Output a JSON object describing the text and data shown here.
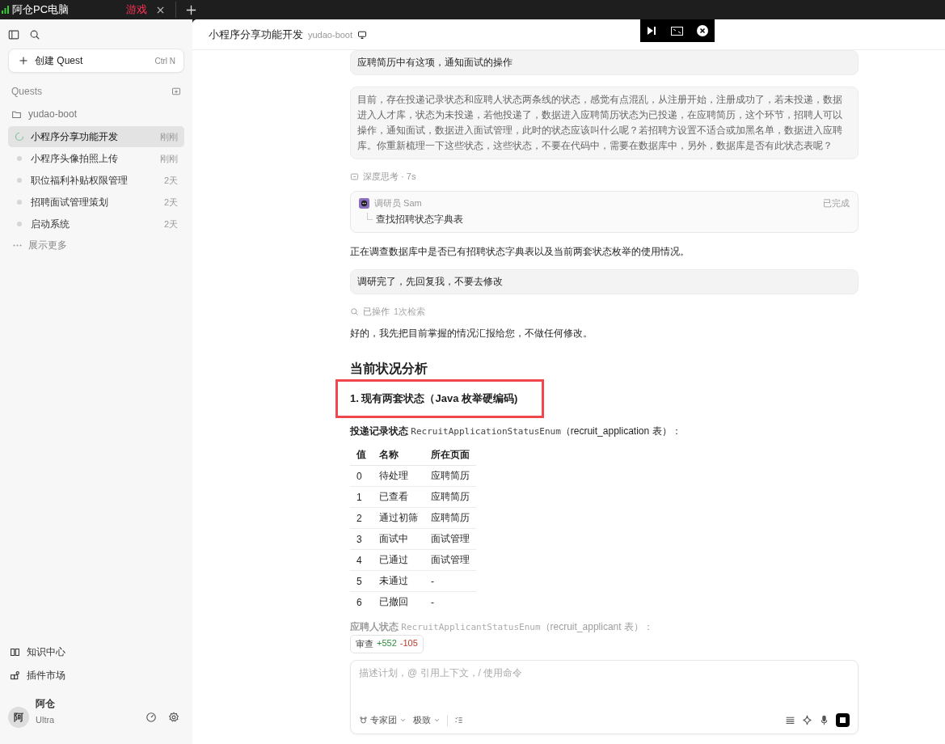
{
  "titlebar": {
    "device": "阿仓PC电脑",
    "tabs": [
      {
        "label": "游戏",
        "selected": true
      }
    ]
  },
  "sidebar": {
    "create": {
      "label": "创建 Quest",
      "shortcut": "Ctrl N"
    },
    "section": "Quests",
    "project": "yudao-boot",
    "items": [
      {
        "label": "小程序分享功能开发",
        "time": "刚刚",
        "selected": true,
        "kind": "running"
      },
      {
        "label": "小程序头像拍照上传",
        "time": "刚刚",
        "selected": false,
        "kind": "idle"
      },
      {
        "label": "职位福利补贴权限管理",
        "time": "2天",
        "selected": false,
        "kind": "idle"
      },
      {
        "label": "招聘面试管理策划",
        "time": "2天",
        "selected": false,
        "kind": "idle"
      },
      {
        "label": "启动系统",
        "time": "2天",
        "selected": false,
        "kind": "idle"
      }
    ],
    "more": "展示更多",
    "links": [
      {
        "label": "知识中心",
        "kind": "book"
      },
      {
        "label": "插件市场",
        "kind": "plugin"
      }
    ],
    "user": {
      "avatar": "阿",
      "name": "阿仓",
      "plan": "Ultra"
    }
  },
  "header": {
    "title": "小程序分享功能开发",
    "project": "yudao-boot"
  },
  "messages": [
    {
      "kind": "user",
      "text": "应聘简历中有这项，通知面试的操作"
    },
    {
      "kind": "user_muted",
      "text": "目前，存在投递记录状态和应聘人状态两条线的状态，感觉有点混乱，从注册开始，注册成功了，若未投递，数据进入人才库，状态为未投递，若他投递了，数据进入应聘简历状态为已投递，在应聘简历，这个环节，招聘人可以操作，通知面试，数据进入面试管理，此时的状态应该叫什么呢？若招聘方设置不适合或加黑名单，数据进入应聘库。你重新梳理一下这些状态，这些状态，不要在代码中，需要在数据库中，另外，数据库是否有此状态表呢？"
    },
    {
      "kind": "thinking",
      "text": "深度思考 · 7s"
    },
    {
      "kind": "agent",
      "name": "调研员 Sam",
      "status": "已完成",
      "task": "查找招聘状态字典表"
    },
    {
      "kind": "text",
      "text": "正在调查数据库中是否已有招聘状态字典表以及当前两套状态枚举的使用情况。"
    },
    {
      "kind": "user",
      "text": "调研完了，先回复我，不要去修改"
    },
    {
      "kind": "operation",
      "text": "已操作",
      "detail": "1次检索"
    },
    {
      "kind": "text",
      "text": "好的，我先把目前掌握的情况汇报给您，不做任何修改。"
    },
    {
      "kind": "h2",
      "text": "当前状况分析"
    },
    {
      "kind": "h3",
      "text": "1. 现有两套状态（Java 枚举硬编码)",
      "highlighted": true
    },
    {
      "kind": "enum",
      "label": "投递记录状态",
      "code": "RecruitApplicationStatusEnum",
      "note": "（recruit_application 表）：",
      "faded": false
    },
    {
      "kind": "table",
      "columns": [
        "值",
        "名称",
        "所在页面"
      ],
      "rows": [
        [
          "0",
          "待处理",
          "应聘简历"
        ],
        [
          "1",
          "已查看",
          "应聘简历"
        ],
        [
          "2",
          "通过初筛",
          "应聘简历"
        ],
        [
          "3",
          "面试中",
          "面试管理"
        ],
        [
          "4",
          "已通过",
          "面试管理"
        ],
        [
          "5",
          "未通过",
          "-"
        ],
        [
          "6",
          "已撤回",
          "-"
        ]
      ]
    },
    {
      "kind": "enum",
      "label": "应聘人状态",
      "code": "RecruitApplicantStatusEnum",
      "note": "（recruit_applicant 表）：",
      "faded": true
    }
  ],
  "review": {
    "label": "审查",
    "added": "+552",
    "removed": "-105"
  },
  "composer": {
    "placeholder": "描述计划，@ 引用上下文，/ 使用命令",
    "agent": "专家团",
    "mode": "极致"
  }
}
